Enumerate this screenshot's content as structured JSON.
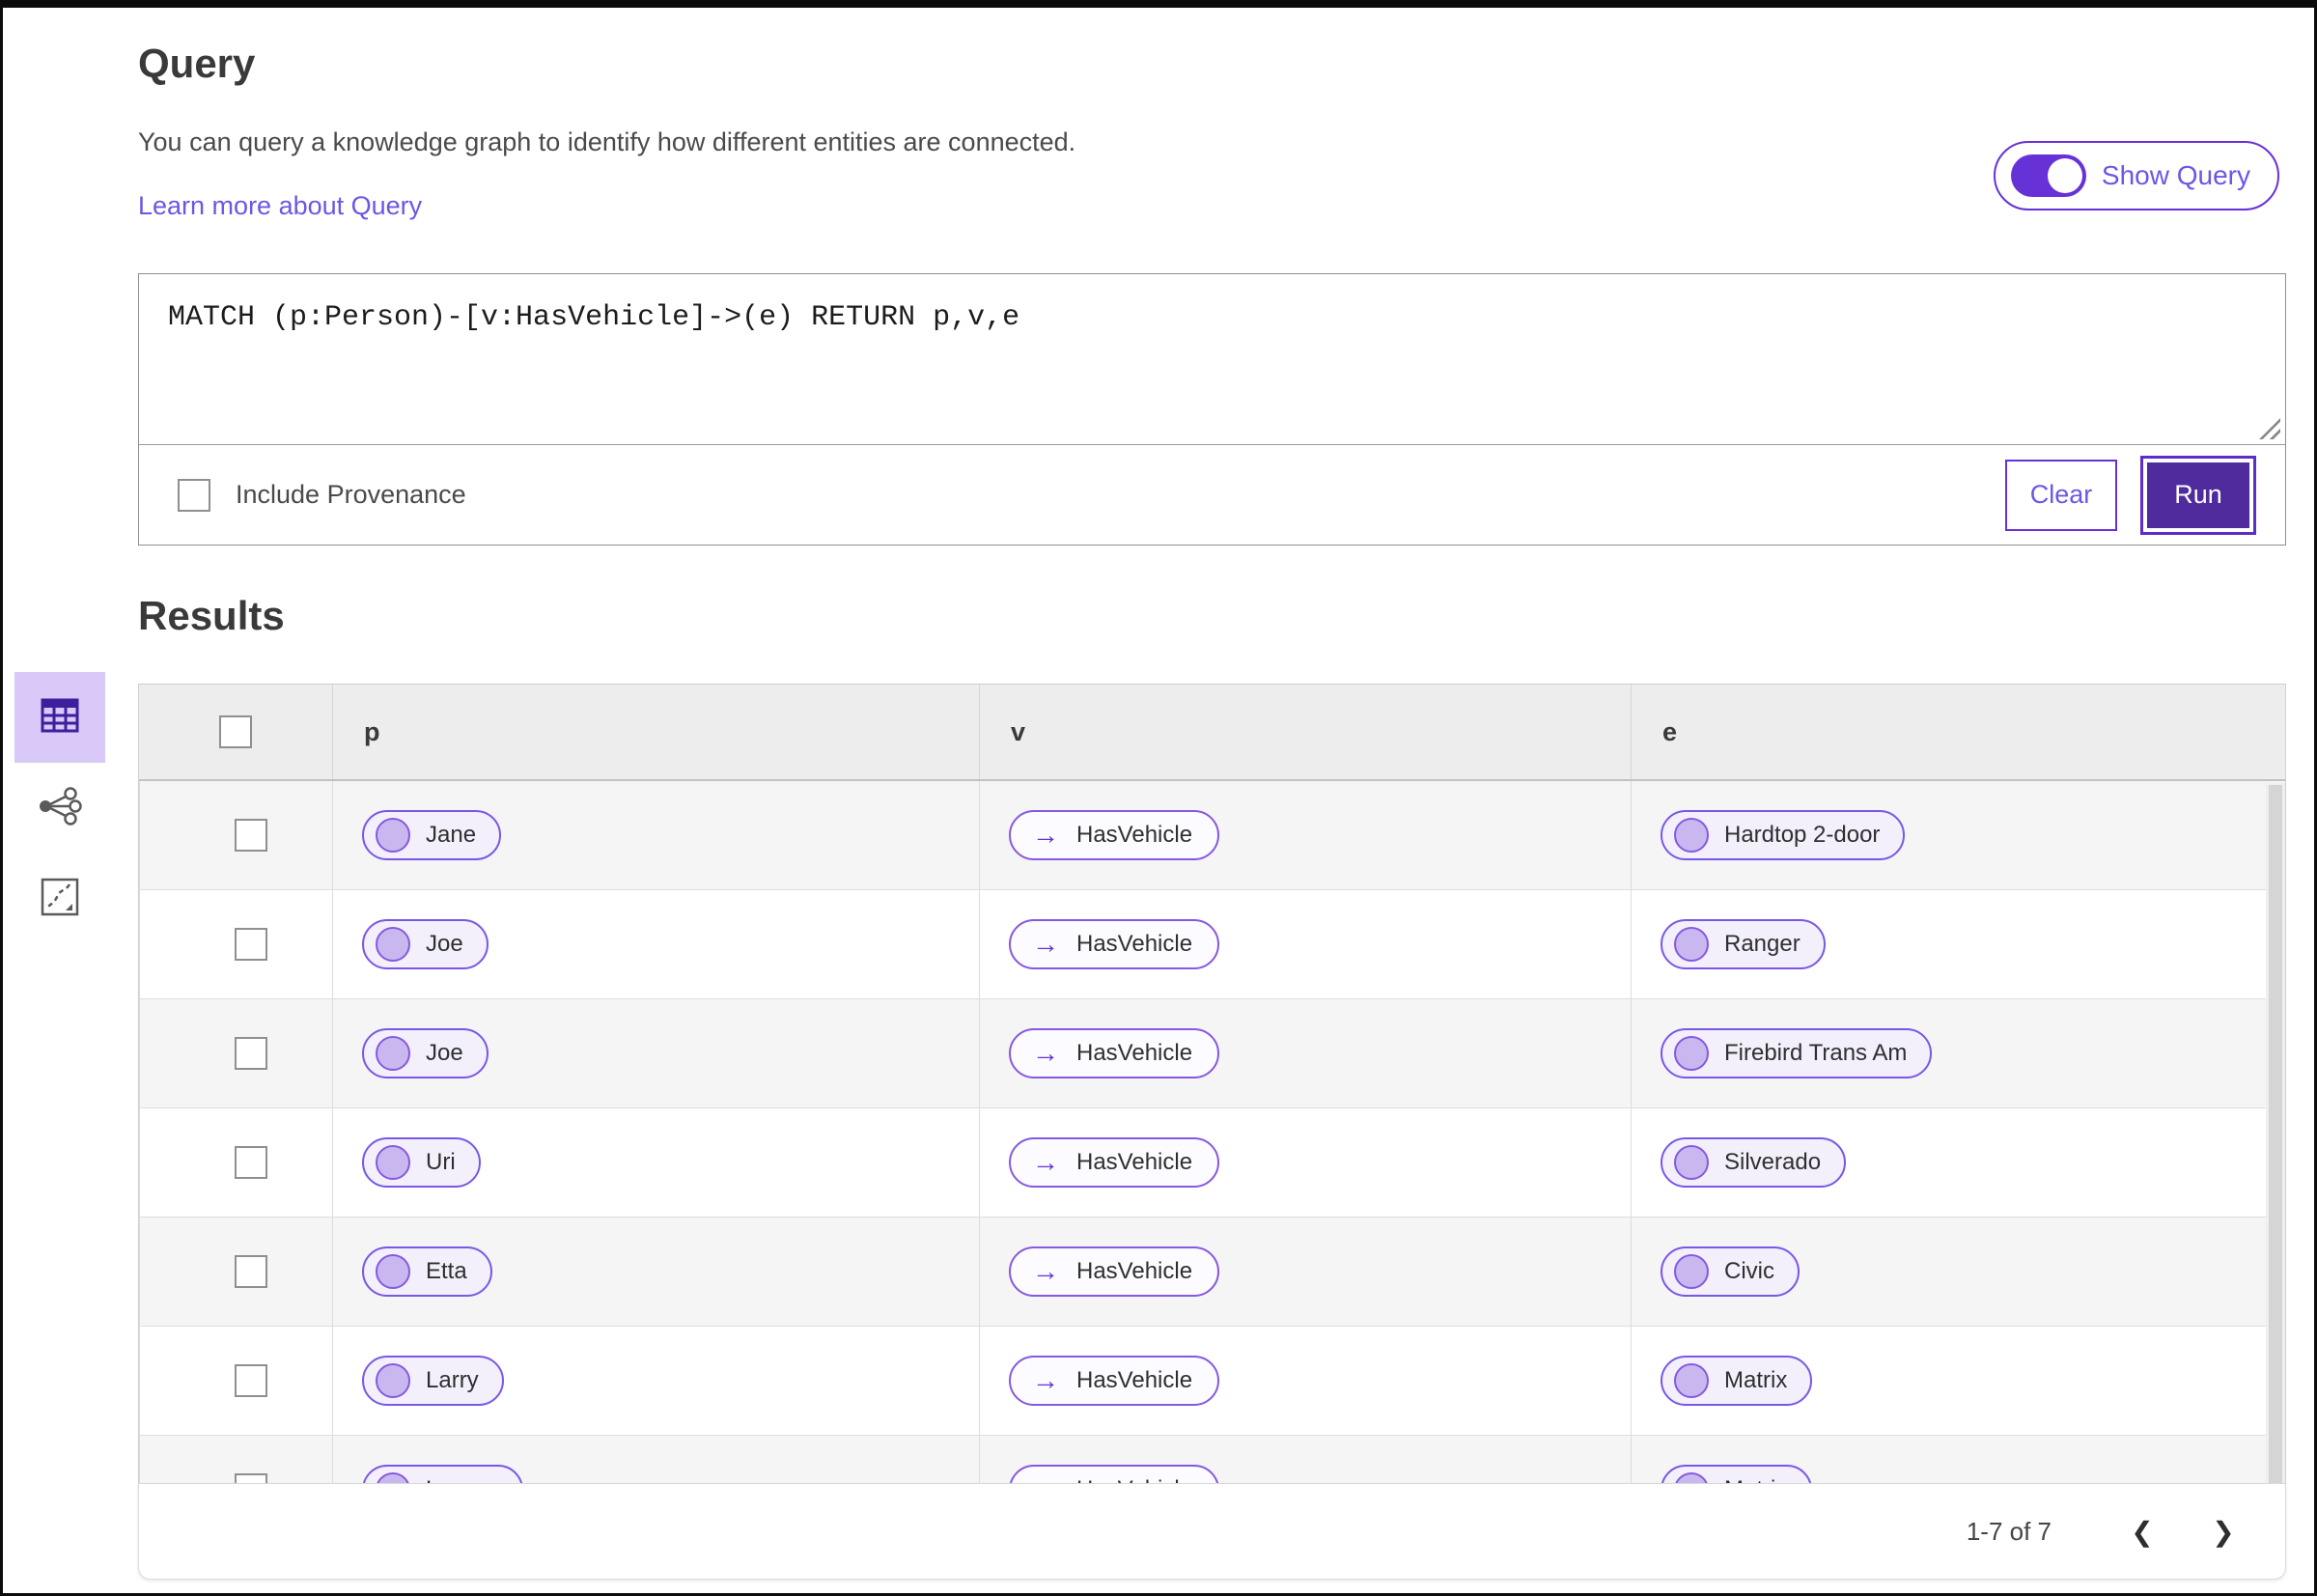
{
  "query": {
    "title": "Query",
    "description": "You can query a knowledge graph to identify how different entities are connected.",
    "learn_more": "Learn more about Query",
    "show_query_toggle": {
      "label": "Show Query",
      "state": "on"
    },
    "editor": {
      "text": "MATCH (p:Person)-[v:HasVehicle]->(e) RETURN p,v,e"
    },
    "include_provenance": {
      "label": "Include Provenance",
      "checked": false
    },
    "buttons": {
      "clear": "Clear",
      "run": "Run"
    }
  },
  "results": {
    "title": "Results",
    "views": [
      {
        "name": "table-view",
        "icon": "table-icon",
        "selected": true
      },
      {
        "name": "graph-view",
        "icon": "network-icon",
        "selected": false
      },
      {
        "name": "map-view",
        "icon": "route-icon",
        "selected": false
      }
    ],
    "table": {
      "columns": [
        "p",
        "v",
        "e"
      ],
      "rows": [
        {
          "p": "Jane",
          "v": "HasVehicle",
          "e": "Hardtop 2-door"
        },
        {
          "p": "Joe",
          "v": "HasVehicle",
          "e": "Ranger"
        },
        {
          "p": "Joe",
          "v": "HasVehicle",
          "e": "Firebird Trans Am"
        },
        {
          "p": "Uri",
          "v": "HasVehicle",
          "e": "Silverado"
        },
        {
          "p": "Etta",
          "v": "HasVehicle",
          "e": "Civic"
        },
        {
          "p": "Larry",
          "v": "HasVehicle",
          "e": "Matrix"
        },
        {
          "p": "Lauren",
          "v": "HasVehicle",
          "e": "Matrix"
        }
      ]
    },
    "pagination": {
      "range": "1-7 of 7"
    }
  },
  "icons": {
    "edge_arrow": "→",
    "chevron_left": "❮",
    "chevron_right": "❯"
  },
  "colors": {
    "accent_purple": "#6731d8",
    "deep_purple": "#4f2b9e",
    "link_purple": "#6b57e6",
    "pill_border": "#7a57e6",
    "pill_bg": "#f3f0fc",
    "node_circle_fill": "#c9b8f0",
    "selected_view_bg": "#d8c9f8",
    "header_bg": "#ededed",
    "row_alt_bg": "#f5f5f5"
  }
}
